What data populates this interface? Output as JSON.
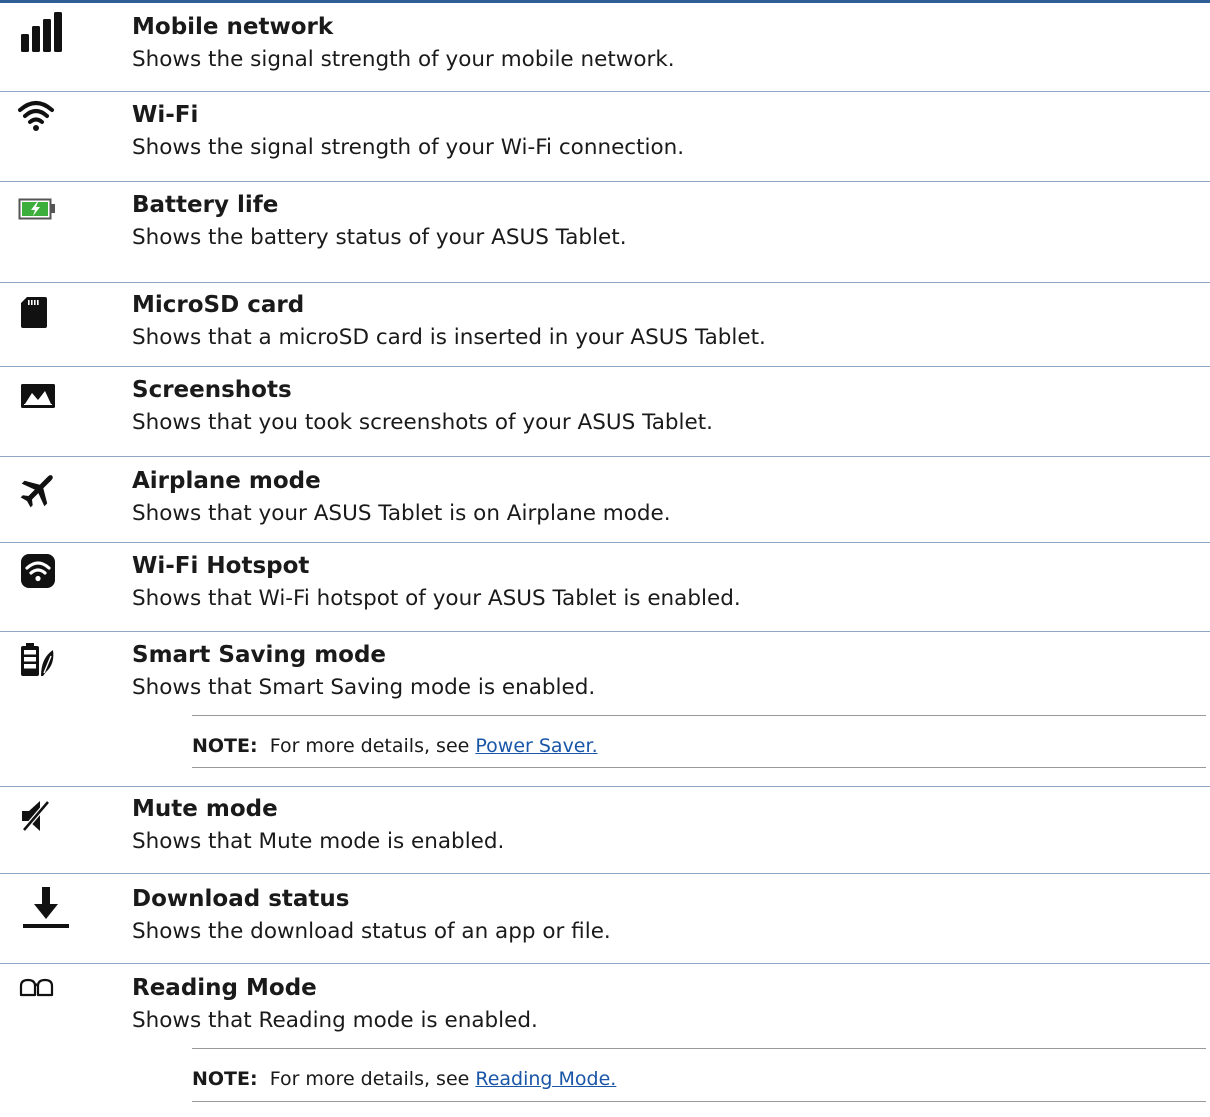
{
  "rows": [
    {
      "icon": "signal-bars-icon",
      "title": "Mobile network",
      "desc": "Shows the signal strength of your mobile network."
    },
    {
      "icon": "wifi-icon",
      "title": "Wi-Fi",
      "desc": "Shows the signal strength of your Wi-Fi connection."
    },
    {
      "icon": "battery-charging-icon",
      "title": "Battery life",
      "desc": "Shows the battery status of your ASUS Tablet."
    },
    {
      "icon": "microsd-card-icon",
      "title": "MicroSD card",
      "desc": "Shows that a microSD card is inserted in your ASUS Tablet."
    },
    {
      "icon": "screenshot-icon",
      "title": "Screenshots",
      "desc": "Shows that you took screenshots of your ASUS Tablet."
    },
    {
      "icon": "airplane-icon",
      "title": "Airplane mode",
      "desc": "Shows that your ASUS Tablet is on Airplane mode."
    },
    {
      "icon": "wifi-hotspot-icon",
      "title": "Wi-Fi Hotspot",
      "desc": "Shows that Wi-Fi hotspot of your ASUS Tablet is enabled."
    },
    {
      "icon": "smart-saving-icon",
      "title": "Smart Saving mode",
      "desc": "Shows that Smart Saving mode is enabled."
    },
    {
      "icon": "mute-icon",
      "title": "Mute mode",
      "desc": "Shows that Mute mode is enabled."
    },
    {
      "icon": "download-icon",
      "title": "Download status",
      "desc": "Shows the download status of an app or file."
    },
    {
      "icon": "reading-glasses-icon",
      "title": "Reading Mode",
      "desc": "Shows that Reading mode is enabled."
    }
  ],
  "notes": {
    "power_saver": {
      "label": "NOTE:",
      "text": "For more details, see",
      "link": "Power Saver."
    },
    "reading_mode": {
      "label": "NOTE:",
      "text": "For more details, see",
      "link": "Reading Mode."
    }
  }
}
